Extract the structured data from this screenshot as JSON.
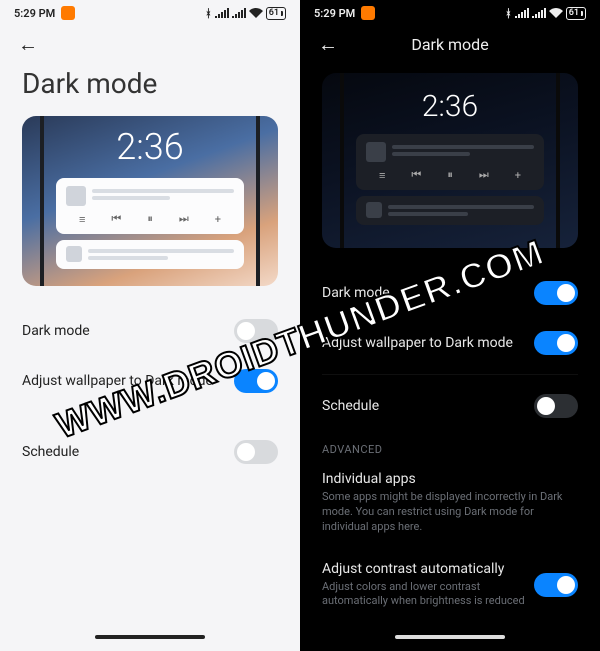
{
  "status": {
    "time": "5:29 PM",
    "battery": "61"
  },
  "light": {
    "page_title": "Dark mode",
    "preview_time": "2:36",
    "dark_mode": {
      "label": "Dark mode",
      "on": false
    },
    "adjust_wallpaper": {
      "label": "Adjust wallpaper to Dark mode",
      "on": true
    },
    "schedule": {
      "label": "Schedule",
      "on": false
    }
  },
  "dark": {
    "header_title": "Dark mode",
    "preview_time": "2:36",
    "dark_mode": {
      "label": "Dark mode",
      "on": true
    },
    "adjust_wallpaper": {
      "label": "Adjust wallpaper to Dark mode",
      "on": true
    },
    "schedule": {
      "label": "Schedule",
      "on": false
    },
    "advanced_label": "ADVANCED",
    "individual_apps": {
      "label": "Individual apps",
      "sub": "Some apps might be displayed incorrectly in Dark mode. You can restrict using Dark mode for individual apps here."
    },
    "adjust_contrast": {
      "label": "Adjust contrast automatically",
      "sub": "Adjust colors and lower contrast automatically when brightness is reduced",
      "on": true
    }
  },
  "watermark": "WWW.DROIDTHUNDER.COM",
  "icons": {
    "prev": "⏮",
    "play": "⏸",
    "next": "⏭",
    "list": "≡",
    "plus": "+"
  }
}
